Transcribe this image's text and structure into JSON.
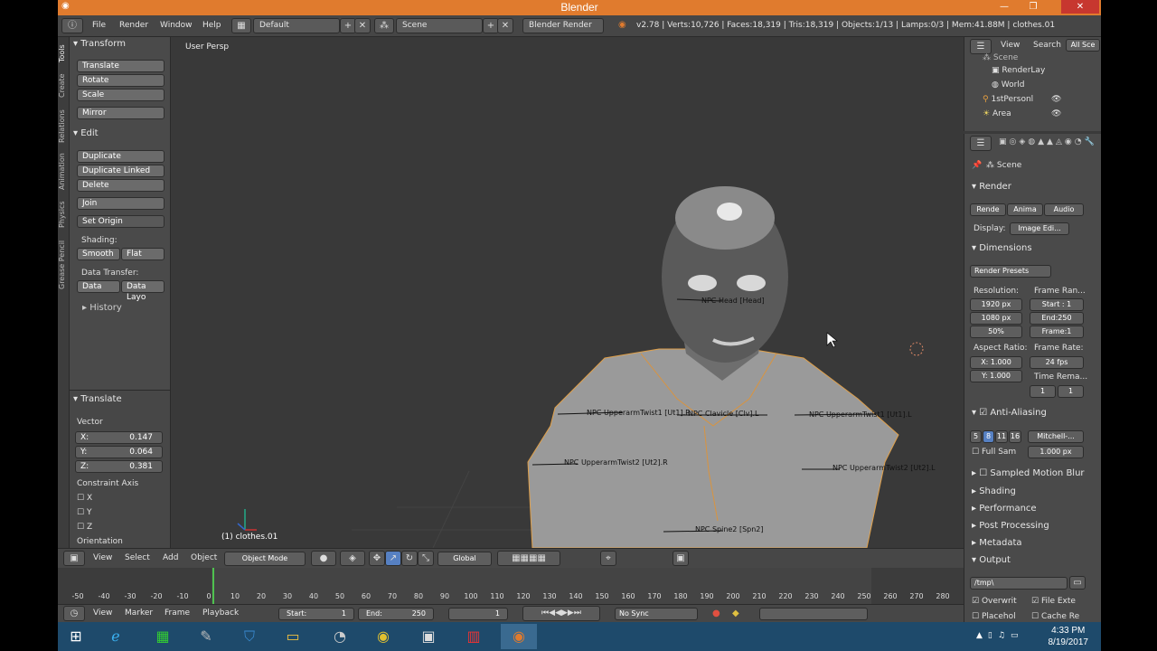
{
  "window": {
    "title": "Blender"
  },
  "menu": {
    "file": "File",
    "render": "Render",
    "window": "Window",
    "help": "Help"
  },
  "layout_field": "Default",
  "scene_field": "Scene",
  "engine": "Blender Render",
  "stats": "v2.78 | Verts:10,726 | Faces:18,319 | Tris:18,319 | Objects:1/13 | Lamps:0/3 | Mem:41.88M | clothes.01",
  "tool_tabs": [
    "Tools",
    "Create",
    "Relations",
    "Animation",
    "Physics",
    "Grease Pencil"
  ],
  "shelf": {
    "transform_header": "Transform",
    "translate": "Translate",
    "rotate": "Rotate",
    "scale": "Scale",
    "mirror": "Mirror",
    "edit_header": "Edit",
    "duplicate": "Duplicate",
    "duplicate_linked": "Duplicate Linked",
    "delete": "Delete",
    "join": "Join",
    "set_origin": "Set Origin",
    "shading_label": "Shading:",
    "smooth": "Smooth",
    "flat": "Flat",
    "data_transfer_label": "Data Transfer:",
    "data": "Data",
    "data_layout": "Data Layo",
    "history_header": "History"
  },
  "operator": {
    "header": "Translate",
    "vector_label": "Vector",
    "x_label": "X:",
    "x": "0.147",
    "y_label": "Y:",
    "y": "0.064",
    "z_label": "Z:",
    "z": "0.381",
    "constraint_label": "Constraint Axis",
    "cx": "X",
    "cy": "Y",
    "cz": "Z",
    "orientation": "Orientation"
  },
  "viewport": {
    "label": "User Persp",
    "object_label": "(1) clothes.01",
    "bones": [
      "NPC Head [Head]",
      "NPC UpperarmTwist1 [Ut1].R",
      "NPC Clavicle [Clv].L",
      "NPC UpperarmTwist1 [Ut1].L",
      "NPC UpperarmTwist2 [Ut2].R",
      "NPC UpperarmTwist2 [Ut2].L",
      "NPC Spine2 [Spn2]"
    ]
  },
  "outliner": {
    "view": "View",
    "search": "Search",
    "all_scenes": "All Sce",
    "items": [
      "Scene",
      "RenderLay",
      "World",
      "1stPersonl",
      "Area"
    ]
  },
  "props": {
    "scene": "Scene",
    "render_header": "Render",
    "render_btn": "Rende",
    "anim_btn": "Anima",
    "audio_btn": "Audio",
    "display_label": "Display:",
    "display_value": "Image Edi...",
    "dimensions_header": "Dimensions",
    "render_presets": "Render Presets",
    "resolution_label": "Resolution:",
    "frame_range_label": "Frame Ran...",
    "res_x": "1920 px",
    "res_y": "1080 px",
    "res_pct": "50%",
    "start": "Start : 1",
    "end": "End:250",
    "frame": "Frame:1",
    "aspect_label": "Aspect Ratio:",
    "framerate_label": "Frame Rate:",
    "aspect_x": "X: 1.000",
    "aspect_y": "Y: 1.000",
    "framerate": "24 fps",
    "time_remap": "Time Rema...",
    "remap_a": "1",
    "remap_b": "1",
    "aa_header": "Anti-Aliasing",
    "aa_5": "5",
    "aa_8": "8",
    "aa_11": "11",
    "aa_16": "16",
    "aa_filter": "Mitchell-...",
    "full_sample": "Full Sam",
    "filter_size": "1.000 px",
    "sampled_motion": "Sampled Motion Blur",
    "shading": "Shading",
    "performance": "Performance",
    "post_processing": "Post Processing",
    "metadata": "Metadata",
    "output": "Output",
    "output_path": "/tmp\\",
    "overwrite": "Overwrit",
    "file_ext": "File Exte",
    "placeholder": "Placehol",
    "cache": "Cache Re"
  },
  "vpheader": {
    "view": "View",
    "select": "Select",
    "add": "Add",
    "object": "Object",
    "mode": "Object Mode",
    "orientation": "Global"
  },
  "timeline": {
    "ticks": [
      "-50",
      "-40",
      "-30",
      "-20",
      "-10",
      "0",
      "10",
      "20",
      "30",
      "40",
      "50",
      "60",
      "70",
      "80",
      "90",
      "100",
      "110",
      "120",
      "130",
      "140",
      "150",
      "160",
      "170",
      "180",
      "190",
      "200",
      "210",
      "220",
      "230",
      "240",
      "250",
      "260",
      "270",
      "280"
    ],
    "current_frame": 1
  },
  "tlheader": {
    "view": "View",
    "marker": "Marker",
    "frame": "Frame",
    "playback": "Playback",
    "start": "Start:",
    "start_val": "1",
    "end": "End:",
    "end_val": "250",
    "current": "1",
    "sync": "No Sync"
  },
  "taskbar": {
    "time": "4:33 PM",
    "date": "8/19/2017"
  }
}
